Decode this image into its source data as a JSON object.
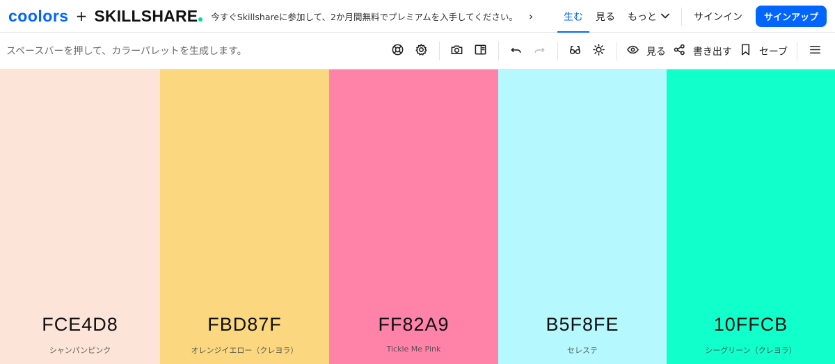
{
  "brand": {
    "coolors": "coolors",
    "plus": "+",
    "skillshare": "SKILLSHARE"
  },
  "promo": {
    "text": "今すぐSkillshareに参加して、2か月間無料でプレミアムを入手してください。",
    "arrow": "›"
  },
  "nav": {
    "generate": "生む",
    "explore": "見る",
    "more": "もっと",
    "signin": "サインイン",
    "signup": "サインアップ"
  },
  "toolbar": {
    "hint": "スペースバーを押して、カラーパレットを生成します。",
    "view_label": "見る",
    "export_label": "書き出す",
    "save_label": "セーブ"
  },
  "palette": [
    {
      "hex": "FCE4D8",
      "name": "シャンパンピンク",
      "color": "#FCE4D8"
    },
    {
      "hex": "FBD87F",
      "name": "オレンジイエロー（クレヨラ）",
      "color": "#FBD87F"
    },
    {
      "hex": "FF82A9",
      "name": "Tickle Me Pink",
      "color": "#FF82A9"
    },
    {
      "hex": "B5F8FE",
      "name": "セレステ",
      "color": "#B5F8FE"
    },
    {
      "hex": "10FFCB",
      "name": "シーグリーン（クレヨラ）",
      "color": "#10FFCB"
    }
  ],
  "colors": {
    "accent": "#0066ff",
    "skillshare_dot": "#00d9a3"
  }
}
